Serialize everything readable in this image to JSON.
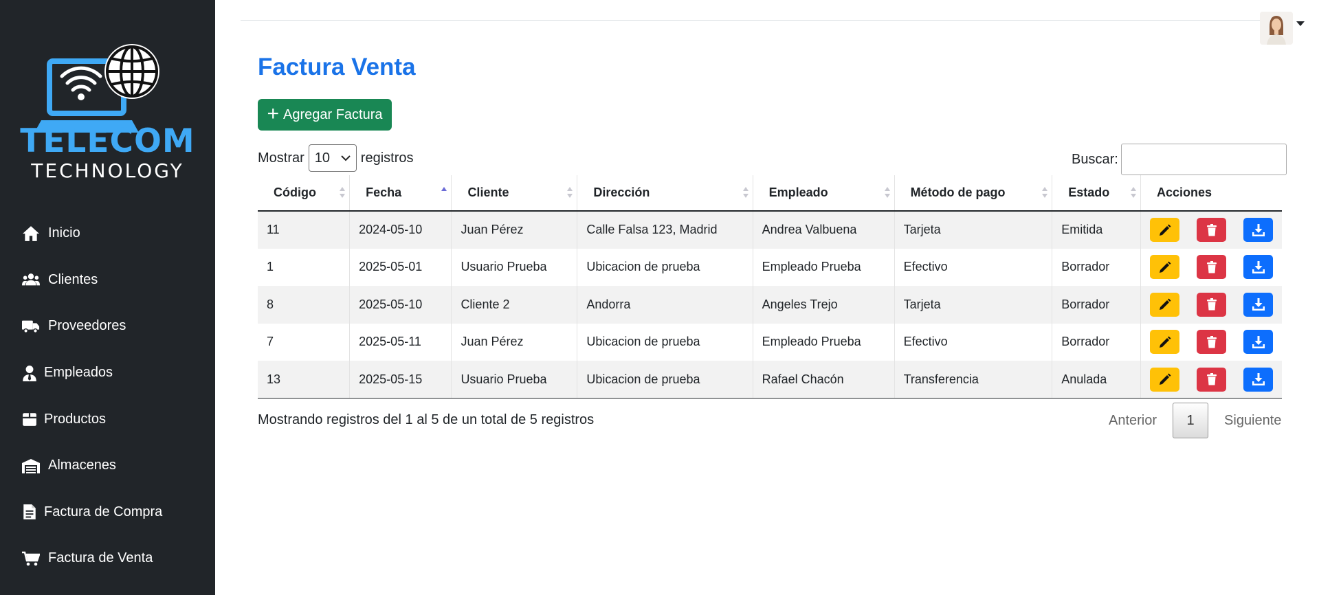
{
  "brand": {
    "line1": "TELECOM",
    "line2": "TECHNOLOGY"
  },
  "sidebar": {
    "items": [
      {
        "label": "Inicio",
        "icon": "home-icon"
      },
      {
        "label": "Clientes",
        "icon": "users-icon"
      },
      {
        "label": "Proveedores",
        "icon": "truck-icon"
      },
      {
        "label": "Empleados",
        "icon": "user-tie-icon"
      },
      {
        "label": "Productos",
        "icon": "box-icon"
      },
      {
        "label": "Almacenes",
        "icon": "warehouse-icon"
      },
      {
        "label": "Factura de Compra",
        "icon": "file-invoice-icon"
      },
      {
        "label": "Factura de Venta",
        "icon": "cart-icon"
      }
    ]
  },
  "header": {
    "avatar": "user-avatar"
  },
  "main": {
    "title": "Factura Venta",
    "add_button": "Agregar Factura",
    "length": {
      "prefix": "Mostrar",
      "value": "10",
      "suffix": "registros"
    },
    "search": {
      "label": "Buscar:",
      "value": ""
    },
    "table": {
      "columns": [
        "Código",
        "Fecha",
        "Cliente",
        "Dirección",
        "Empleado",
        "Método de pago",
        "Estado",
        "Acciones"
      ],
      "sorted_column": "Fecha",
      "rows": [
        {
          "codigo": "11",
          "fecha": "2024-05-10",
          "cliente": "Juan Pérez",
          "direccion": "Calle Falsa 123, Madrid",
          "empleado": "Andrea Valbuena",
          "metodo": "Tarjeta",
          "estado": "Emitida"
        },
        {
          "codigo": "1",
          "fecha": "2025-05-01",
          "cliente": "Usuario Prueba",
          "direccion": "Ubicacion de prueba",
          "empleado": "Empleado Prueba",
          "metodo": "Efectivo",
          "estado": "Borrador"
        },
        {
          "codigo": "8",
          "fecha": "2025-05-10",
          "cliente": "Cliente 2",
          "direccion": "Andorra",
          "empleado": "Angeles Trejo",
          "metodo": "Tarjeta",
          "estado": "Borrador"
        },
        {
          "codigo": "7",
          "fecha": "2025-05-11",
          "cliente": "Juan Pérez",
          "direccion": "Ubicacion de prueba",
          "empleado": "Empleado Prueba",
          "metodo": "Efectivo",
          "estado": "Borrador"
        },
        {
          "codigo": "13",
          "fecha": "2025-05-15",
          "cliente": "Usuario Prueba",
          "direccion": "Ubicacion de prueba",
          "empleado": "Rafael Chacón",
          "metodo": "Transferencia",
          "estado": "Anulada"
        }
      ]
    },
    "info": "Mostrando registros del 1 al 5 de un total de 5 registros",
    "pagination": {
      "prev": "Anterior",
      "current": "1",
      "next": "Siguiente"
    }
  },
  "colors": {
    "sidebar_bg": "#212529",
    "brand_blue": "#3fa9f5",
    "title_blue": "#1a73e8",
    "add_green": "#198754",
    "edit_yellow": "#ffc107",
    "delete_red": "#dc3545",
    "download_blue": "#0d6efd"
  }
}
